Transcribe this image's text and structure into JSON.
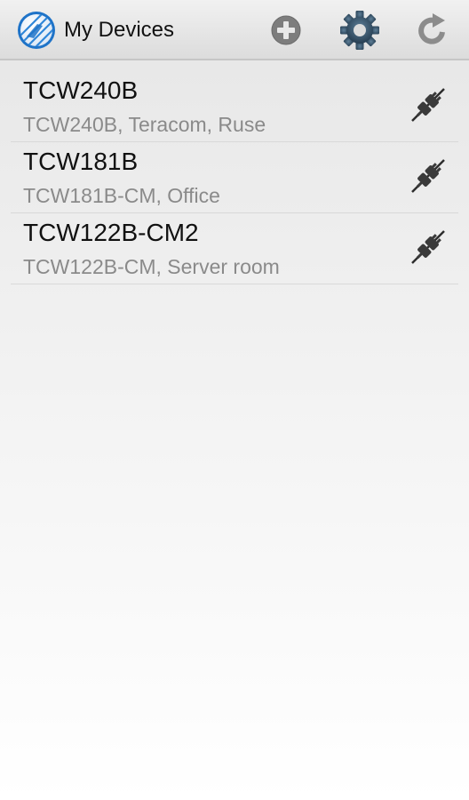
{
  "app": {
    "title": "My Devices",
    "logo_icon": "teracom-logo-icon",
    "accent_color": "#1e73c8"
  },
  "actions": {
    "add_icon": "add-circle-icon",
    "settings_icon": "gear-icon",
    "refresh_icon": "refresh-icon"
  },
  "devices": [
    {
      "name": "TCW240B",
      "description": "TCW240B, Teracom, Ruse",
      "status_icon": "disconnected-plug-icon"
    },
    {
      "name": "TCW181B",
      "description": "TCW181B-CM, Office",
      "status_icon": "disconnected-plug-icon"
    },
    {
      "name": "TCW122B-CM2",
      "description": "TCW122B-CM, Server room",
      "status_icon": "disconnected-plug-icon"
    }
  ]
}
